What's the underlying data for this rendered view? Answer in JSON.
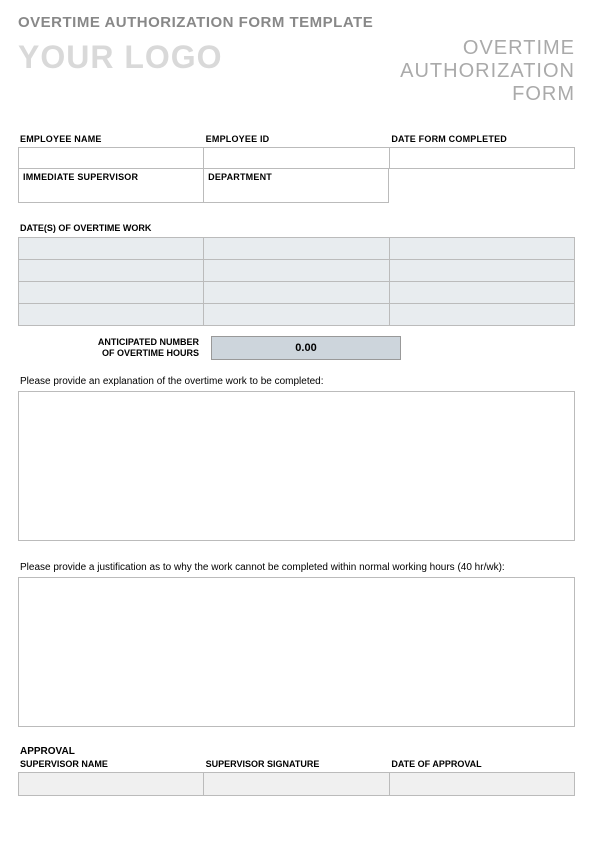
{
  "page_title": "OVERTIME AUTHORIZATION FORM TEMPLATE",
  "logo_text": "YOUR LOGO",
  "form_title_l1": "OVERTIME",
  "form_title_l2": "AUTHORIZATION",
  "form_title_l3": "FORM",
  "fields": {
    "employee_name_label": "EMPLOYEE NAME",
    "employee_id_label": "EMPLOYEE ID",
    "date_completed_label": "DATE FORM COMPLETED",
    "supervisor_label": "IMMEDIATE SUPERVISOR",
    "department_label": "DEPARTMENT",
    "employee_name": "",
    "employee_id": "",
    "date_completed": "",
    "supervisor": "",
    "department": ""
  },
  "dates_label": "DATE(S) OF OVERTIME WORK",
  "dates_grid": [
    [
      "",
      "",
      ""
    ],
    [
      "",
      "",
      ""
    ],
    [
      "",
      "",
      ""
    ],
    [
      "",
      "",
      ""
    ]
  ],
  "anticipated": {
    "label_l1": "ANTICIPATED NUMBER",
    "label_l2": "OF OVERTIME HOURS",
    "value": "0.00"
  },
  "explanation_prompt": "Please provide an explanation of the overtime work to be completed:",
  "explanation_value": "",
  "justification_prompt": "Please provide a justification as to why the work cannot be completed within normal working hours (40 hr/wk):",
  "justification_value": "",
  "approval": {
    "heading": "APPROVAL",
    "supervisor_name_label": "SUPERVISOR NAME",
    "supervisor_sig_label": "SUPERVISOR SIGNATURE",
    "date_label": "DATE OF APPROVAL",
    "supervisor_name": "",
    "supervisor_sig": "",
    "date": ""
  }
}
